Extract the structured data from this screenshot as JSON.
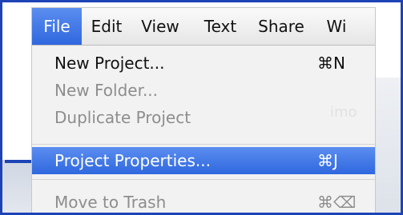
{
  "menubar": {
    "items": [
      "File",
      "Edit",
      "View",
      "Text",
      "Share",
      "Wi"
    ],
    "active_index": 0
  },
  "file_menu": {
    "items": [
      {
        "label": "New Project...",
        "shortcut": "⌘N",
        "enabled": true
      },
      {
        "label": "New Folder...",
        "shortcut": "",
        "enabled": false
      },
      {
        "label": "Duplicate Project",
        "shortcut": "",
        "enabled": false
      },
      {
        "label": "Project Properties...",
        "shortcut": "⌘J",
        "enabled": true,
        "highlighted": true
      },
      {
        "label": "Move to Trash",
        "shortcut": "⌘⌫",
        "enabled": false
      }
    ]
  },
  "background_text": "imo"
}
